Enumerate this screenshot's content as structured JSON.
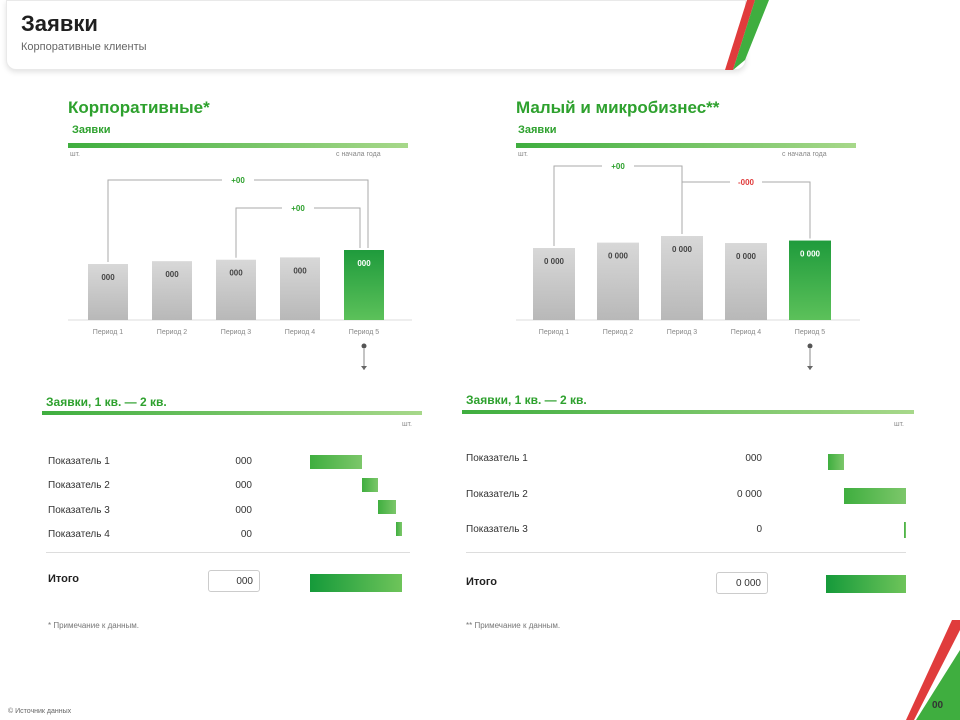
{
  "header": {
    "title": "Заявки",
    "subtitle": "Корпоративные клиенты"
  },
  "left": {
    "section_title": "Корпоративные*",
    "section_sub": "Заявки",
    "unit_left": "шт.",
    "unit_right": "с начала года",
    "panel_title": "Заявки, 1 кв. — 2 кв.",
    "panel_unit": "шт.",
    "rows": [
      {
        "label": "Показатель 1",
        "value": "000"
      },
      {
        "label": "Показатель 2",
        "value": "000"
      },
      {
        "label": "Показатель 3",
        "value": "000"
      },
      {
        "label": "Показатель 4",
        "value": "00"
      }
    ],
    "total_label": "Итого",
    "total_value": "000",
    "footnote": "* Примечание к данным.",
    "brace_labels": [
      "+00",
      "+00"
    ]
  },
  "right": {
    "section_title": "Малый и микробизнес**",
    "section_sub": "Заявки",
    "unit_left": "шт.",
    "unit_right": "с начала года",
    "panel_title": "Заявки, 1 кв. — 2 кв.",
    "panel_unit": "шт.",
    "rows": [
      {
        "label": "Показатель 1",
        "value": "000"
      },
      {
        "label": "Показатель 2",
        "value": "0 000"
      },
      {
        "label": "Показатель 3",
        "value": "0"
      }
    ],
    "total_label": "Итого",
    "total_value": "0 000",
    "footnote": "** Примечание к данным.",
    "brace_labels": [
      "+00",
      "-000"
    ]
  },
  "footer": "© Источник данных",
  "page_number": "00",
  "colors": {
    "accent_green": "#2ea12e",
    "bar_gray": "#c8c8c8",
    "negative_red": "#e03c3c"
  },
  "chart_data": [
    {
      "type": "bar",
      "title": "Корпоративные*",
      "categories": [
        "Период 1",
        "Период 2",
        "Период 3",
        "Период 4",
        "Период 5"
      ],
      "values": [
        629,
        681,
        707,
        750,
        885
      ],
      "value_labels": [
        "000",
        "000",
        "000",
        "000",
        "000"
      ],
      "highlight_index": 4
    },
    {
      "type": "bar",
      "title": "Малый и микробизнес**",
      "categories": [
        "Период 1",
        "Период 2",
        "Период 3",
        "Период 4",
        "Период 5"
      ],
      "values": [
        2290,
        2420,
        2580,
        2410,
        2470
      ],
      "value_labels": [
        "0 000",
        "0 000",
        "0 000",
        "0 000",
        "0 000"
      ],
      "highlight_index": 4
    }
  ]
}
